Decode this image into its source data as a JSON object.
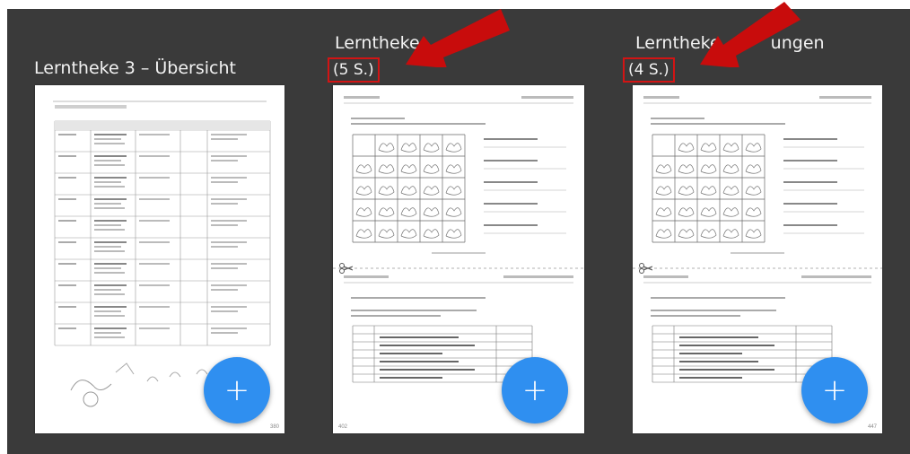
{
  "cards": [
    {
      "title": "Lerntheke 3 – Übersicht",
      "pages": "",
      "page_number": "380",
      "add_label": "+"
    },
    {
      "title": "Lerntheke",
      "pages": "(5 S.)",
      "page_number": "402",
      "add_label": "+"
    },
    {
      "title_left": "Lerntheke",
      "title_right": "ungen",
      "pages": "(4 S.)",
      "page_number": "447",
      "add_label": "+"
    }
  ],
  "colors": {
    "background": "#3a3a3a",
    "highlight_box": "#d21414",
    "arrow": "#c80c0c",
    "fab": "#2f8ff0"
  },
  "icons": [
    "plus-icon",
    "scissors-icon",
    "red-arrow-annotation"
  ]
}
